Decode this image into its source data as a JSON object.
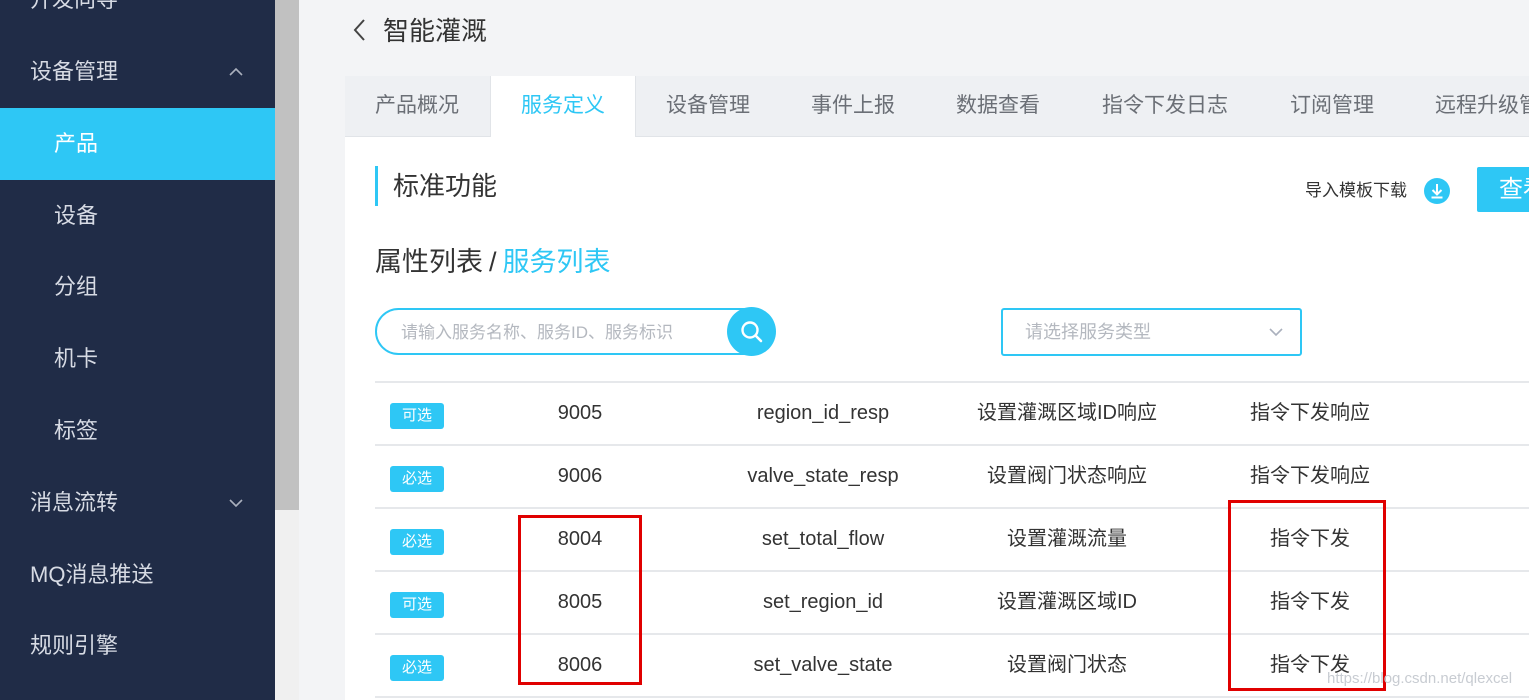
{
  "sidebar": {
    "cut_top_item": "开发向导",
    "device_mgmt": "设备管理",
    "items": [
      "产品",
      "设备",
      "分组",
      "机卡",
      "标签"
    ],
    "message_flow": "消息流转",
    "mq_push": "MQ消息推送",
    "rule_engine": "规则引擎"
  },
  "header": {
    "title": "智能灌溉"
  },
  "tabs": [
    "产品概况",
    "服务定义",
    "设备管理",
    "事件上报",
    "数据查看",
    "指令下发日志",
    "订阅管理",
    "远程升级管"
  ],
  "section": {
    "title": "标准功能",
    "import_label": "导入模板下载",
    "view_label": "查看"
  },
  "list_toggle": {
    "properties": "属性列表",
    "separator": "/",
    "services": "服务列表"
  },
  "search": {
    "placeholder": "请输入服务名称、服务ID、服务标识",
    "value": ""
  },
  "type_select": {
    "placeholder": "请选择服务类型"
  },
  "rows": [
    {
      "badge": "可选",
      "id": "9005",
      "identifier": "region_id_resp",
      "name": "设置灌溉区域ID响应",
      "type": "指令下发响应"
    },
    {
      "badge": "必选",
      "id": "9006",
      "identifier": "valve_state_resp",
      "name": "设置阀门状态响应",
      "type": "指令下发响应"
    },
    {
      "badge": "必选",
      "id": "8004",
      "identifier": "set_total_flow",
      "name": "设置灌溉流量",
      "type": "指令下发"
    },
    {
      "badge": "可选",
      "id": "8005",
      "identifier": "set_region_id",
      "name": "设置灌溉区域ID",
      "type": "指令下发"
    },
    {
      "badge": "必选",
      "id": "8006",
      "identifier": "set_valve_state",
      "name": "设置阀门状态",
      "type": "指令下发"
    }
  ],
  "watermark": "https://blog.csdn.net/qlexcel",
  "colors": {
    "accent": "#2ec7f5",
    "sidebar": "#202c47",
    "annotation": "#e00000"
  }
}
